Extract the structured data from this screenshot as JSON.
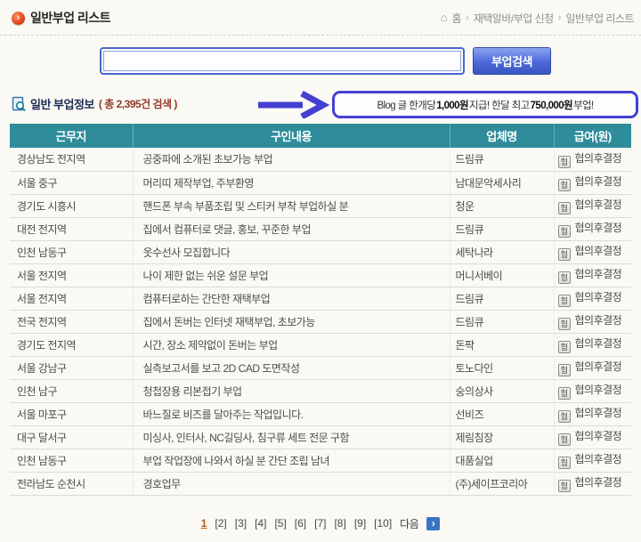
{
  "page": {
    "title": "일반부업 리스트",
    "breadcrumb": {
      "home": "홈",
      "sep": "›",
      "items": [
        "재택알바/부업 신청",
        "일반부업 리스트"
      ]
    }
  },
  "search": {
    "input_value": "",
    "button_label": "부업검색"
  },
  "info": {
    "section_title": "일반 부업정보",
    "result_count": "( 총 2,395건 검색 )",
    "announcement": {
      "parts": [
        "Blog 글 한개당 ",
        "1,000원",
        " 지급! 한달 최고 ",
        "750,000원",
        " 부업!"
      ]
    }
  },
  "icons": {
    "title_bullet": "›",
    "home": "⌂",
    "next": "›",
    "pay_badge": "협"
  },
  "table": {
    "columns": [
      "근무지",
      "구인내용",
      "업체명",
      "급여(원)"
    ],
    "rows": [
      {
        "location": "경상남도 전지역",
        "description": "공중파에 소개된 초보가능 부업",
        "company": "드림큐",
        "pay": "협의후결정"
      },
      {
        "location": "서울 중구",
        "description": "머리띠 제작부업, 주부환영",
        "company": "남대문악세사리",
        "pay": "협의후결정"
      },
      {
        "location": "경기도 시흥시",
        "description": "핸드폰 부속 부품조립 및 스티커 부착 부업하실 분",
        "company": "청운",
        "pay": "협의후결정"
      },
      {
        "location": "대전 전지역",
        "description": "집에서 컴퓨터로 댓글, 홍보, 꾸준한 부업",
        "company": "드림큐",
        "pay": "협의후결정"
      },
      {
        "location": "인천 남동구",
        "description": "옷수선사 모집합니다",
        "company": "세탁나라",
        "pay": "협의후결정"
      },
      {
        "location": "서울 전지역",
        "description": "나이 제한 없는 쉬운 설문 부업",
        "company": "머니서베이",
        "pay": "협의후결정"
      },
      {
        "location": "서울 전지역",
        "description": "컴퓨터로하는 간단한 재택부업",
        "company": "드림큐",
        "pay": "협의후결정"
      },
      {
        "location": "전국 전지역",
        "description": "집에서 돈버는 인터넷 재택부업, 초보가능",
        "company": "드림큐",
        "pay": "협의후결정"
      },
      {
        "location": "경기도 전지역",
        "description": "시간, 장소 제약없이 돈버는 부업",
        "company": "돈팍",
        "pay": "협의후결정"
      },
      {
        "location": "서울 강남구",
        "description": "실측보고서를 보고 2D CAD 도면작성",
        "company": "토노다인",
        "pay": "협의후결정"
      },
      {
        "location": "인천 남구",
        "description": "청첩장용 리본접기 부업",
        "company": "숭의상사",
        "pay": "협의후결정"
      },
      {
        "location": "서울 마포구",
        "description": "바느질로 비즈를 달아주는 작업입니다.",
        "company": "선비즈",
        "pay": "협의후결정"
      },
      {
        "location": "대구 달서구",
        "description": "미싱사, 인터사, NC길딩사, 침구류 세트 전문 구함",
        "company": "제림침장",
        "pay": "협의후결정"
      },
      {
        "location": "인천 남동구",
        "description": "부업 작업장에 나와서 하실 분 간단 조립 남녀",
        "company": "대품실업",
        "pay": "협의후결정"
      },
      {
        "location": "전라남도 순천시",
        "description": "경호업무",
        "company": "(주)세이프코리아",
        "pay": "협의후결정"
      }
    ]
  },
  "pagination": {
    "current": "1",
    "pages": [
      "[2]",
      "[3]",
      "[4]",
      "[5]",
      "[6]",
      "[7]",
      "[8]",
      "[9]",
      "[10]"
    ],
    "next_label": "다음"
  },
  "colors": {
    "table_header_teal": "#2E8C9B",
    "promo_blue": "#4540D2",
    "count_maroon": "#943A28",
    "current_page_orange": "#BC5A1A",
    "search_button_blue": "#4A68D8"
  }
}
